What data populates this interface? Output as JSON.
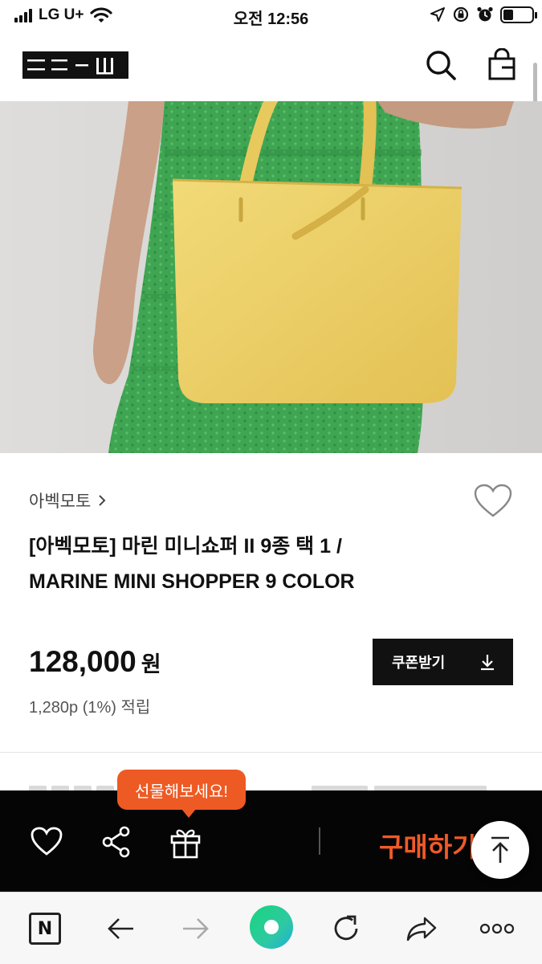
{
  "status_bar": {
    "carrier": "LG U+",
    "time": "오전 12:56",
    "icons": [
      "signal-icon",
      "wifi-icon",
      "location-arrow-icon",
      "orientation-lock-icon",
      "alarm-icon",
      "battery-icon"
    ]
  },
  "header": {
    "logo_alt": "site-logo",
    "icons": [
      "search-icon",
      "shopping-bag-icon"
    ]
  },
  "product": {
    "brand": "아벡모토",
    "title_line1": "[아벡모토] 마린 미니쇼퍼 II 9종 택 1 /",
    "title_line2": "MARINE MINI SHOPPER 9 COLOR",
    "price": "128,000",
    "price_unit": "원",
    "points": "1,280p (1%) 적립",
    "coupon_label": "쿠폰받기",
    "colors": {
      "bag_yellow": "#efd36a",
      "dress_green": "#3fa552",
      "background": "#d7d6d4"
    }
  },
  "purchase_bar": {
    "gift_tooltip": "선물해보세요!",
    "buy_label": "구매하기",
    "icons": [
      "heart-icon",
      "share-icon",
      "gift-icon",
      "arrow-up-icon"
    ],
    "accent": "#f05a28"
  },
  "browser_bar": {
    "n_label": "N",
    "icons": [
      "naver-n-icon",
      "back-arrow-icon",
      "forward-arrow-icon",
      "green-home-icon",
      "reload-icon",
      "share-arrow-icon",
      "more-icon"
    ]
  }
}
